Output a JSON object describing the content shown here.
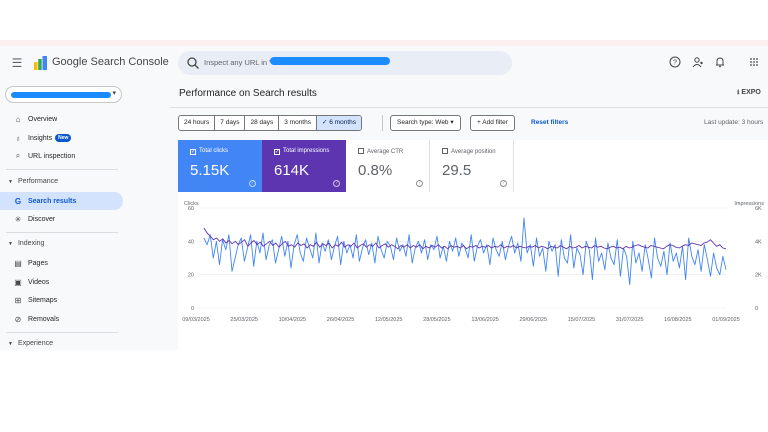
{
  "header": {
    "product_name": "Google Search Console",
    "search_placeholder": "Inspect any URL in \"",
    "icons": [
      "menu-icon",
      "help-icon",
      "manage-users-icon",
      "notifications-icon",
      "apps-grid-icon"
    ]
  },
  "sidebar": {
    "items": [
      {
        "label": "Overview",
        "icon": "home-icon"
      },
      {
        "label": "Insights",
        "icon": "insights-icon",
        "badge": "New"
      },
      {
        "label": "URL inspection",
        "icon": "search-icon"
      }
    ],
    "sections": [
      {
        "title": "Performance",
        "items": [
          {
            "label": "Search results",
            "icon": "google-g-icon",
            "active": true
          },
          {
            "label": "Discover",
            "icon": "discover-icon"
          }
        ]
      },
      {
        "title": "Indexing",
        "items": [
          {
            "label": "Pages",
            "icon": "pages-icon"
          },
          {
            "label": "Videos",
            "icon": "videos-icon"
          },
          {
            "label": "Sitemaps",
            "icon": "sitemaps-icon"
          },
          {
            "label": "Removals",
            "icon": "removals-icon"
          }
        ]
      },
      {
        "title": "Experience",
        "items": []
      }
    ]
  },
  "main": {
    "title": "Performance on Search results",
    "export_label": "EXPO",
    "date_ranges": [
      "24 hours",
      "7 days",
      "28 days",
      "3 months",
      "6 months"
    ],
    "selected_range": "6 months",
    "search_type": "Search type: Web",
    "add_filter": "+ Add filter",
    "reset_filters": "Reset filters",
    "last_update": "Last update: 3 hours",
    "metrics": [
      {
        "label": "Total clicks",
        "value": "5.15K",
        "checked": true,
        "color": "#4285f4"
      },
      {
        "label": "Total impressions",
        "value": "614K",
        "checked": true,
        "color": "#5e35b1"
      },
      {
        "label": "Average CTR",
        "value": "0.8%",
        "checked": false
      },
      {
        "label": "Average position",
        "value": "29.5",
        "checked": false
      }
    ]
  },
  "colors": {
    "clicks": "#4285f4",
    "impressions": "#5e35b1",
    "accent": "#0b57d0"
  },
  "chart_data": {
    "type": "line",
    "left_axis_label": "Clicks",
    "right_axis_label": "Impressions",
    "left_ticks": [
      "60",
      "40",
      "20",
      "0"
    ],
    "right_ticks": [
      "6K",
      "4K",
      "2K",
      "0"
    ],
    "ylim_left": [
      0,
      60
    ],
    "ylim_right": [
      0,
      6000
    ],
    "x_tick_labels": [
      "09/03/2025",
      "25/03/2025",
      "10/04/2025",
      "26/04/2025",
      "12/05/2025",
      "28/05/2025",
      "13/06/2025",
      "29/06/2025",
      "15/07/2025",
      "31/07/2025",
      "16/08/2025",
      "01/09/2025"
    ],
    "series": [
      {
        "name": "Clicks",
        "axis": "left",
        "values": [
          42,
          38,
          44,
          30,
          40,
          26,
          41,
          35,
          44,
          22,
          30,
          38,
          42,
          28,
          36,
          44,
          25,
          40,
          33,
          45,
          29,
          38,
          41,
          27,
          35,
          43,
          31,
          40,
          24,
          38,
          44,
          33,
          28,
          42,
          36,
          30,
          45,
          27,
          39,
          34,
          41,
          29,
          37,
          43,
          26,
          40,
          33,
          38,
          30,
          44,
          28,
          36,
          41,
          32,
          39,
          27,
          43,
          35,
          30,
          40,
          37,
          29,
          42,
          34,
          38,
          31,
          44,
          27,
          36,
          40,
          33,
          41,
          29,
          38,
          35,
          43,
          30,
          37,
          28,
          40,
          34,
          42,
          31,
          39,
          36,
          30,
          44,
          28,
          37,
          41,
          33,
          38,
          26,
          42,
          35,
          31,
          40,
          29,
          37,
          43,
          33,
          39,
          28,
          54,
          33,
          38,
          25,
          42,
          31,
          36,
          22,
          40,
          34,
          38,
          19,
          41,
          30,
          27,
          44,
          24,
          36,
          32,
          20,
          40,
          35,
          17,
          42,
          28,
          33,
          23,
          39,
          30,
          26,
          41,
          19,
          36,
          31,
          14,
          40,
          27,
          33,
          22,
          38,
          29,
          18,
          42,
          30,
          25,
          34,
          20,
          39,
          28,
          33,
          24,
          37,
          17,
          42,
          31,
          26,
          35,
          22,
          38,
          29,
          19,
          33,
          24,
          20,
          31,
          23
        ]
      },
      {
        "name": "Impressions",
        "axis": "right",
        "values": [
          4800,
          4500,
          4300,
          4100,
          4200,
          4000,
          4150,
          3900,
          4050,
          3850,
          4000,
          3800,
          3950,
          4100,
          3700,
          3900,
          4050,
          3800,
          3950,
          3700,
          3850,
          4000,
          3750,
          3900,
          3650,
          3850,
          4000,
          3700,
          3800,
          3650,
          3900,
          3750,
          3850,
          3600,
          3800,
          3700,
          3950,
          3650,
          3850,
          3750,
          3900,
          3600,
          3800,
          3700,
          3950,
          3650,
          3800,
          3700,
          3900,
          3600,
          3750,
          3850,
          3650,
          3800,
          3700,
          3900,
          3600,
          3750,
          3850,
          3650,
          3800,
          3700,
          3550,
          3750,
          3650,
          3800,
          3600,
          3750,
          3650,
          3800,
          3550,
          3700,
          3600,
          3750,
          3650,
          3800,
          3600,
          3700,
          3550,
          3750,
          3650,
          3700,
          3600,
          3750,
          3550,
          3700,
          3650,
          3750,
          3600,
          3700,
          3650,
          3750,
          3600,
          3700,
          3650,
          3800,
          3600,
          3700,
          3650,
          3750,
          3600,
          3700,
          3650,
          3600,
          3700,
          3650,
          3750,
          3600,
          3700,
          3650,
          3550,
          3700,
          3650,
          3600,
          3750,
          3650,
          3550,
          3700,
          3600,
          3650,
          3750,
          3600,
          3700,
          3650,
          3600,
          3750,
          3650,
          3700,
          3600,
          3550,
          3650,
          3700,
          3600,
          3650,
          3550,
          3700,
          3600,
          3650,
          3750,
          3800,
          3700,
          3650,
          3600,
          3750,
          3700,
          3650,
          3600,
          3550,
          3700,
          3800,
          3750,
          3650,
          3600,
          3700,
          3800,
          3750,
          3900,
          3850,
          3800,
          3750,
          3900,
          3950,
          4100,
          3900,
          3700,
          3800,
          3600,
          3550
        ]
      }
    ],
    "grid": true,
    "legend": "none"
  }
}
